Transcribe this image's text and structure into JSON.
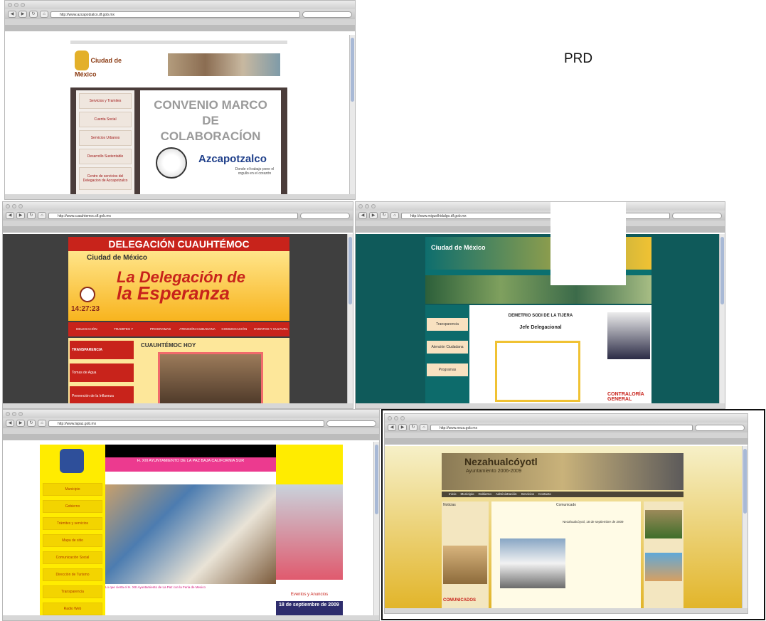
{
  "label": "PRD",
  "windows": {
    "w1": {
      "url": "http://www.azcapotzalco.df.gob.mx",
      "nav": [
        "Servicios y Tramites",
        "Cuenta Social",
        "Servicios Urbanos",
        "Desarrollo Sustentable",
        "Centro de servicios del Delegacion de Azcapotzalco"
      ],
      "heading_line1": "CONVENIO MARCO",
      "heading_line2": "DE",
      "heading_line3": "COLABORACÍON",
      "logo_text": "Azcapotzalco",
      "city_logo": "Ciudad de México",
      "caption": "Donde el trabajo pone el orgullo en el corazón"
    },
    "w2": {
      "url": "http://www.cuauhtemoc.df.gob.mx",
      "banner_title": "DELEGACIÓN CUAUHTÉMOC",
      "slogan_line1": "La Delegación de",
      "slogan_line2": "la Esperanza",
      "city_logo": "Ciudad de México",
      "clock": "14:27:23",
      "nav": [
        "DELEGACIÓN",
        "TRAMITES Y SERVICIOS",
        "PROGRAMAS",
        "ATENCIÓN CIUDADANA",
        "COMUNICACIÓN SOCIAL",
        "EVENTOS Y CULTURA"
      ],
      "side": [
        "TRANSPARENCIA",
        "Tomas de Agua",
        "Prevención de la Influenza"
      ],
      "section": "CUAUHTÉMOC HOY"
    },
    "w3": {
      "url": "http://www.miguelhidalgo.df.gob.mx",
      "city_logo": "Ciudad de México",
      "person_name": "DEMETRIO SODI DE LA TIJERA",
      "person_title": "Jefe Delegacional",
      "side": [
        "Transparencia",
        "Atención Ciudadana",
        "Programas"
      ],
      "footer_text": "CONTRALORÍA GENERAL"
    },
    "w4": {
      "url": "http://www.lapaz.gob.mx",
      "banner": "H. XIII AYUNTAMIENTO DE LA PAZ BAJA CALIFORNIA SUR",
      "menu": [
        "Municipio",
        "Gobierno",
        "Trámites y servicios",
        "Mapa de sitio",
        "Comunicación Social",
        "Dirección de Turismo",
        "Transparencia",
        "Radio Web"
      ],
      "date_badge": "18 de septiembre de 2009",
      "news_caption": "Lo que cierta el H. XIII Ayuntamiento de La Paz con la Feria de Mexico",
      "events_label": "Eventos y Anuncios"
    },
    "w5": {
      "url": "http://www.neza.gob.mx",
      "banner_title": "Nezahualcóyotl",
      "banner_sub": "Ayuntamiento 2006-2009",
      "nav": [
        "Inicio",
        "Municipio",
        "Gobierno",
        "Administración",
        "Servicios",
        "Contacto"
      ],
      "side_header": "Noticias",
      "main_header": "Comunicado",
      "sub_header": "Nezahualcóyotl, 18 de septiembre de 2009",
      "side_item": "COMUNICADOS"
    }
  }
}
